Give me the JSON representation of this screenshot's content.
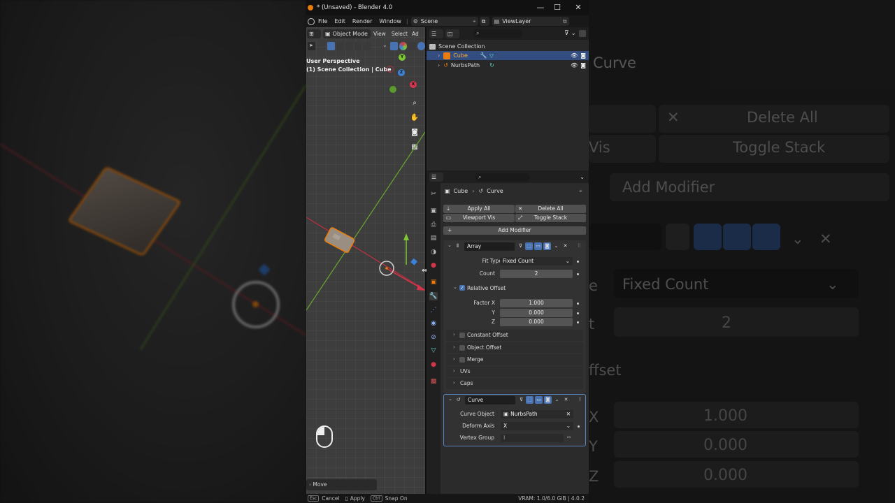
{
  "window": {
    "title": "* (Unsaved) - Blender 4.0",
    "minimize": "—",
    "maximize": "☐",
    "close": "✕"
  },
  "menu": {
    "items": [
      "File",
      "Edit",
      "Render",
      "Window",
      "|"
    ],
    "scene_label": "Scene",
    "viewlayer_label": "ViewLayer"
  },
  "viewport": {
    "mode": "Object Mode",
    "menu": [
      "View",
      "Select",
      "Ad"
    ],
    "perspective": "User Perspective",
    "collection_info": "(1) Scene Collection | Cube",
    "operator_panel": "Move",
    "gizmo": {
      "x": "X",
      "y": "Y",
      "z": "Z"
    }
  },
  "outliner": {
    "root": "Scene Collection",
    "items": [
      {
        "name": "Cube",
        "selected": true
      },
      {
        "name": "NurbsPath",
        "selected": false
      }
    ]
  },
  "properties": {
    "breadcrumb": {
      "object": "Cube",
      "data": "Curve"
    },
    "buttons": {
      "apply_all": "Apply All",
      "delete_all": "Delete All",
      "viewport_vis": "Viewport Vis",
      "toggle_stack": "Toggle Stack",
      "add_modifier": "Add Modifier"
    },
    "array": {
      "name": "Array",
      "fit_type_label": "Fit Type",
      "fit_type": "Fixed Count",
      "count_label": "Count",
      "count": "2",
      "relative_offset_label": "Relative Offset",
      "factor_x_label": "Factor X",
      "factor_x": "1.000",
      "y_label": "Y",
      "factor_y": "0.000",
      "z_label": "Z",
      "factor_z": "0.000",
      "subpanels": [
        "Constant Offset",
        "Object Offset",
        "Merge",
        "UVs",
        "Caps"
      ]
    },
    "curve": {
      "name": "Curve",
      "curve_object_label": "Curve Object",
      "curve_object": "NurbsPath",
      "deform_axis_label": "Deform Axis",
      "deform_axis": "X",
      "vertex_group_label": "Vertex Group"
    }
  },
  "statusbar": {
    "cancel": "Cancel",
    "apply": "Apply",
    "snap": "Snap On",
    "vram": "VRAM: 1.0/6.0 GiB | 4.0.2"
  },
  "background_zoom": {
    "header": "Curve",
    "delete_all": "Delete All",
    "vis_partial": "Vis",
    "toggle_stack": "Toggle Stack",
    "add_modifier": "Add Modifier",
    "fit_partial": "e",
    "fit_value": "Fixed Count",
    "count_partial": "t",
    "count_value": "2",
    "offset_partial": "ffset",
    "x": "X",
    "x_value": "1.000",
    "y": "Y",
    "y_value": "0.000",
    "z": "Z",
    "z_value": "0.000"
  },
  "colors": {
    "accent": "#4772b3",
    "selection_orange": "#e87d0d",
    "x_axis": "#d3364a",
    "y_axis": "#7ec733",
    "z_axis": "#3b83d6"
  }
}
